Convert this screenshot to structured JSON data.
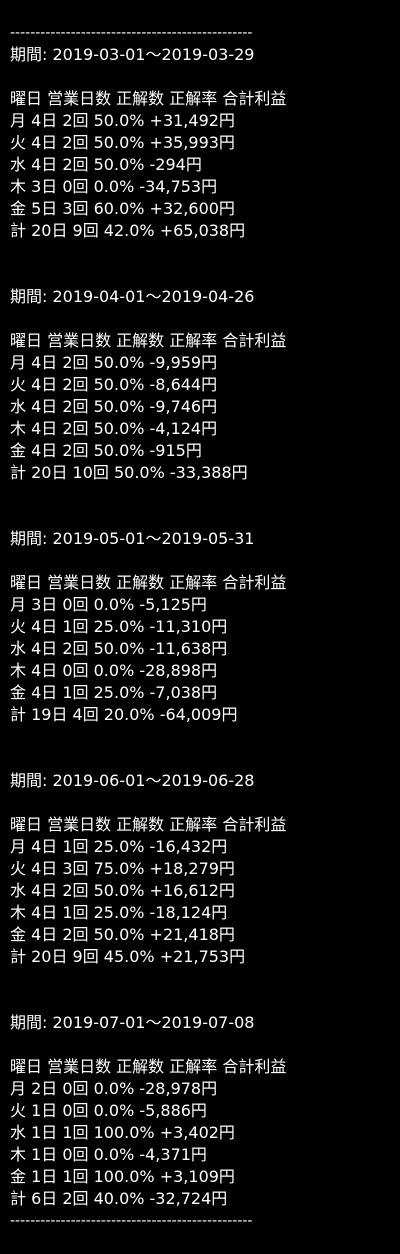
{
  "divider": "------------------------------------------------",
  "period_label": "期間:",
  "header_row": "曜日 営業日数 正解数 正解率 合計利益",
  "periods": [
    {
      "range": "2019-03-01～2019-03-29",
      "rows": [
        "月 4日 2回 50.0% +31,492円",
        "火 4日 2回 50.0% +35,993円",
        "水 4日 2回 50.0% -294円",
        "木 3日 0回 0.0% -34,753円",
        "金 5日 3回 60.0% +32,600円",
        "計 20日 9回 42.0% +65,038円"
      ]
    },
    {
      "range": "2019-04-01～2019-04-26",
      "rows": [
        "月 4日 2回 50.0% -9,959円",
        "火 4日 2回 50.0% -8,644円",
        "水 4日 2回 50.0% -9,746円",
        "木 4日 2回 50.0% -4,124円",
        "金 4日 2回 50.0% -915円",
        "計 20日 10回 50.0% -33,388円"
      ]
    },
    {
      "range": "2019-05-01～2019-05-31",
      "rows": [
        "月 3日 0回 0.0% -5,125円",
        "火 4日 1回 25.0% -11,310円",
        "水 4日 2回 50.0% -11,638円",
        "木 4日 0回 0.0% -28,898円",
        "金 4日 1回 25.0% -7,038円",
        "計 19日 4回 20.0% -64,009円"
      ]
    },
    {
      "range": "2019-06-01～2019-06-28",
      "rows": [
        "月 4日 1回 25.0% -16,432円",
        "火 4日 3回 75.0% +18,279円",
        "水 4日 2回 50.0% +16,612円",
        "木 4日 1回 25.0% -18,124円",
        "金 4日 2回 50.0% +21,418円",
        "計 20日 9回 45.0% +21,753円"
      ]
    },
    {
      "range": "2019-07-01～2019-07-08",
      "rows": [
        "月 2日 0回 0.0% -28,978円",
        "火 1日 0回 0.0% -5,886円",
        "水 1日 1回 100.0% +3,402円",
        "木 1日 0回 0.0% -4,371円",
        "金 1日 1回 100.0% +3,109円",
        "計 6日 2回 40.0% -32,724円"
      ]
    }
  ]
}
